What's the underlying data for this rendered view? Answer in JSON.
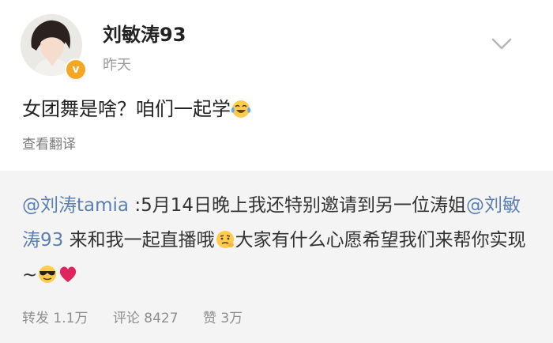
{
  "post": {
    "username": "刘敏涛93",
    "timestamp": "昨天",
    "text": "女团舞是啥？咱们一起学",
    "text_emoji": "laughing-tears-emoji",
    "translate_label": "查看翻译",
    "verified_badge": "v",
    "verified_color": "#f5a623"
  },
  "repost": {
    "mention_author": "@刘涛tamia",
    "text_part1": " :5月14日晚上我还特别邀请到另一位涛姐",
    "mention_inline": "@刘敏涛93",
    "text_part2": " 来和我一起直播哦",
    "emoji1": "thinking-smirk-emoji",
    "text_part3": "大家有什么心愿希望我们来帮你实现 ~",
    "emoji2": "sunglasses-emoji",
    "emoji3": "red-heart-emoji",
    "mention_color": "#5b7fb0",
    "stats": {
      "repost_label": "转发",
      "repost_count": "1.1万",
      "comment_label": "评论",
      "comment_count": "8427",
      "like_label": "赞",
      "like_count": "3万"
    }
  }
}
